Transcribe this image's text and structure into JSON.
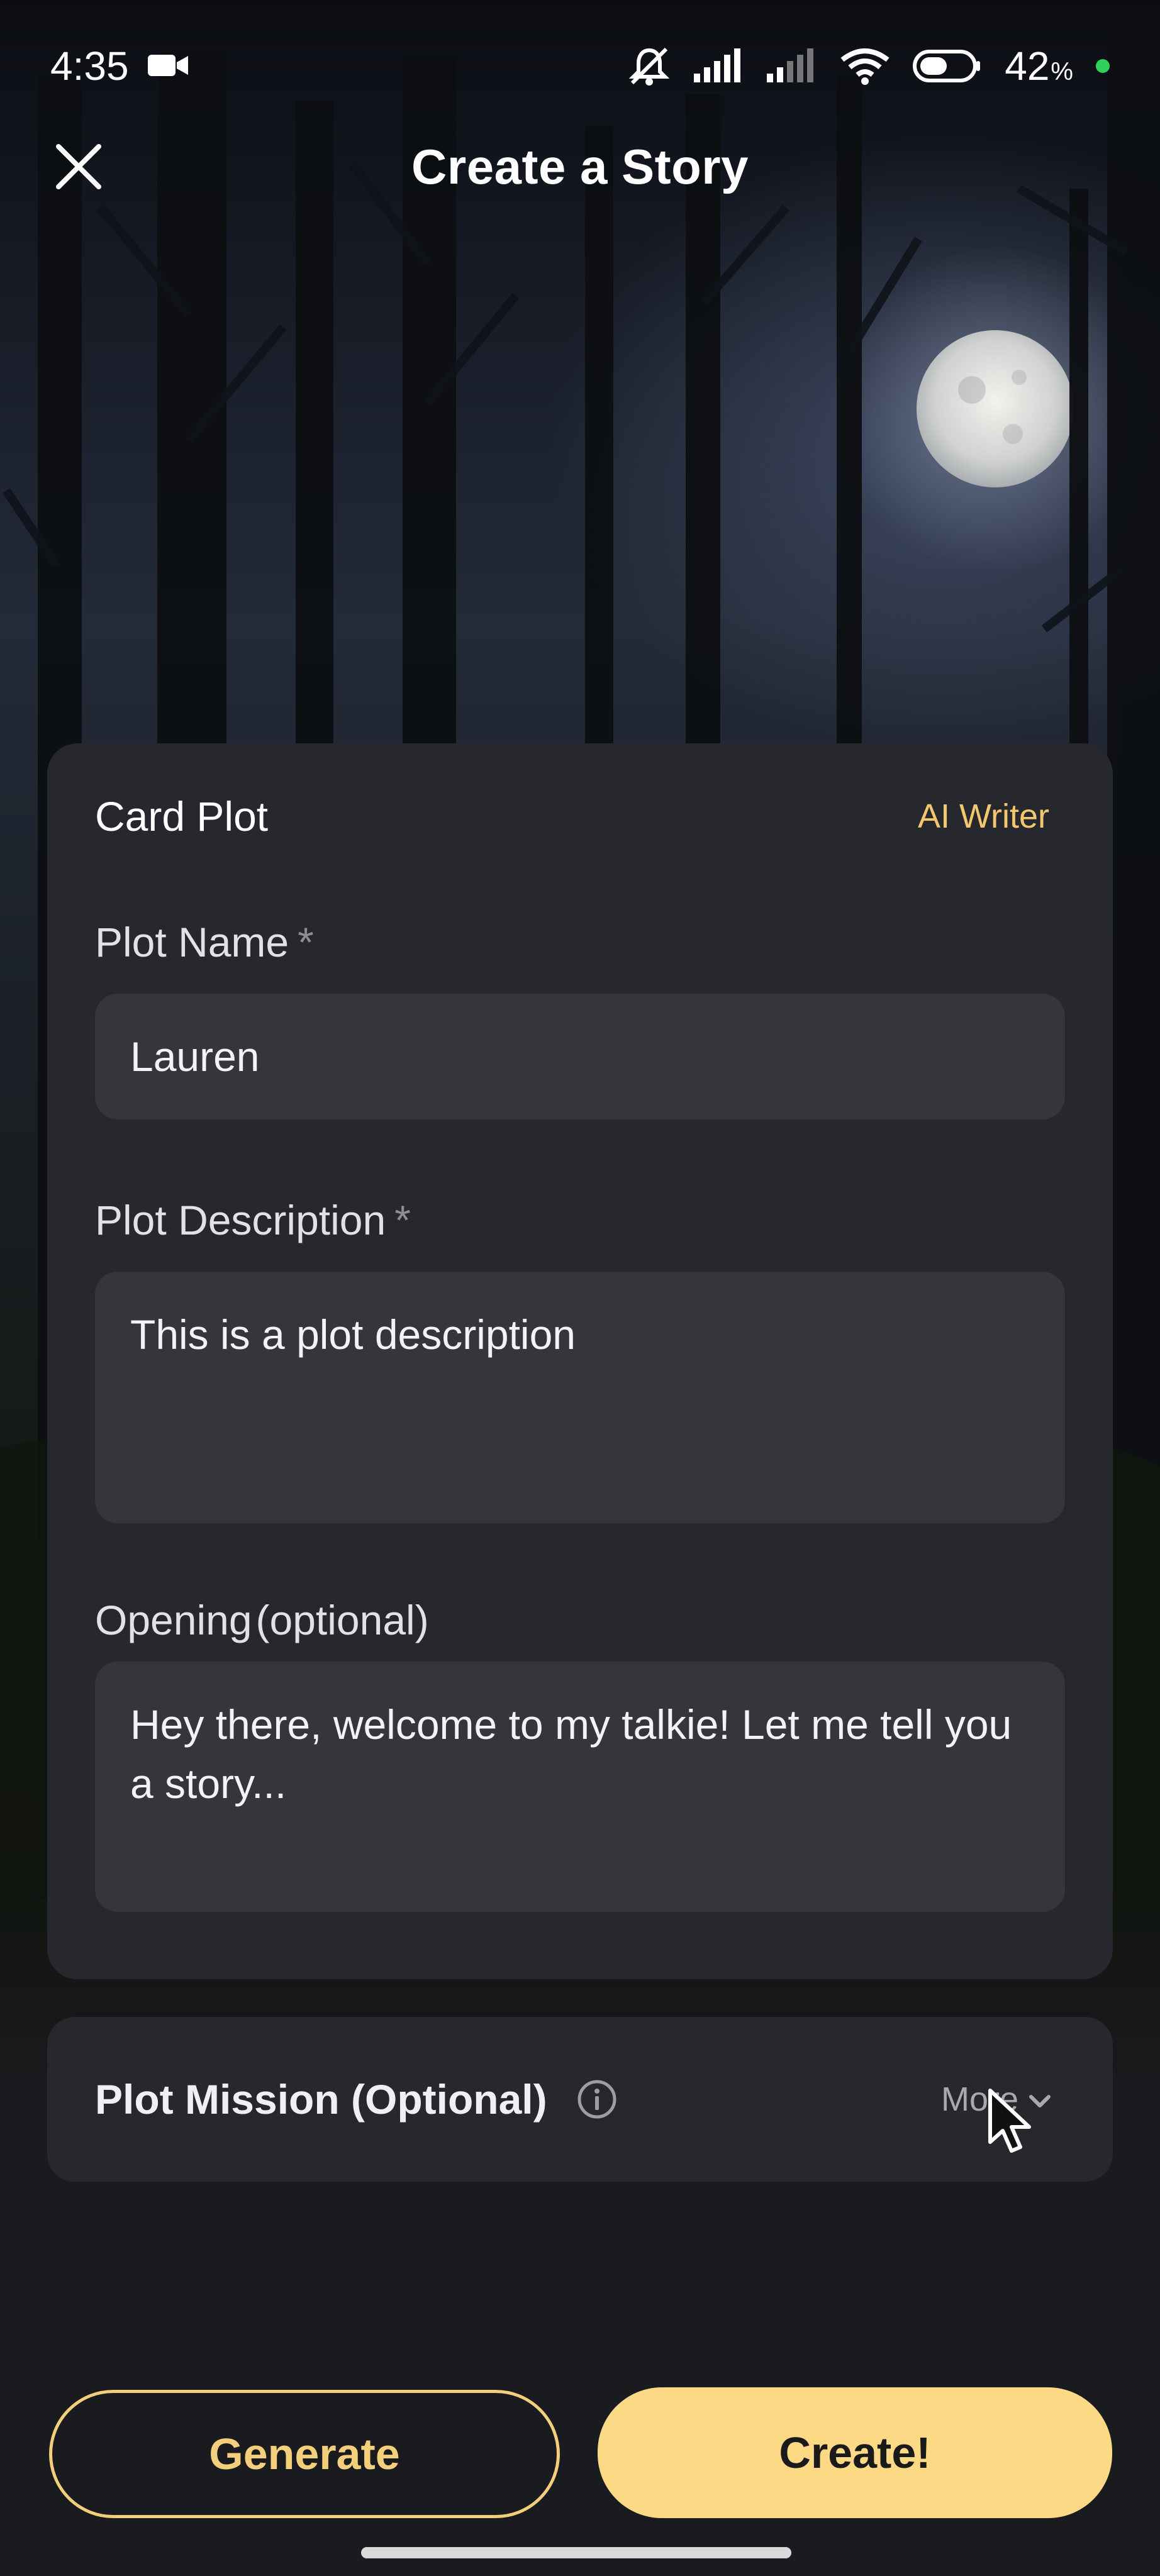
{
  "status_bar": {
    "time": "4:35",
    "battery_percent": "42",
    "battery_unit": "%",
    "icons": [
      "video-camera-icon",
      "muted-bell-icon",
      "signal-icon",
      "signal-icon",
      "wifi-icon",
      "battery-icon"
    ]
  },
  "header": {
    "title": "Create a Story",
    "close_icon": "close-icon"
  },
  "card": {
    "title": "Card Plot",
    "ai_writer_label": "AI Writer",
    "plot_name_label": "Plot Name",
    "plot_name_value": "Lauren",
    "plot_description_label": "Plot Description",
    "plot_description_value": "This is a plot description",
    "required_mark": "*",
    "opening_label": "Opening",
    "opening_optional": "(optional)",
    "opening_value": "Hey there, welcome to my talkie! Let me tell you a story..."
  },
  "mission": {
    "title": "Plot Mission (Optional)",
    "more_label": "More"
  },
  "actions": {
    "generate_label": "Generate",
    "create_label": "Create!"
  },
  "colors": {
    "accent": "#fbd985",
    "accent_text": "#f2c76e",
    "card_bg": "#27282d",
    "field_bg": "#35363c",
    "page_bg": "#1a1b1f"
  }
}
